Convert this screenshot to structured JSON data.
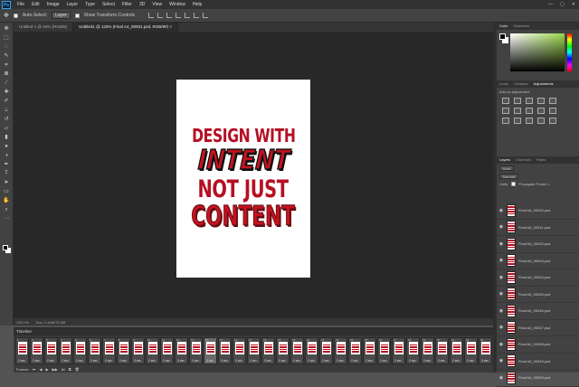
{
  "app": {
    "logo": "Ps"
  },
  "menu": [
    "File",
    "Edit",
    "Image",
    "Layer",
    "Type",
    "Select",
    "Filter",
    "3D",
    "View",
    "Window",
    "Help"
  ],
  "window_controls": [
    "—",
    "▢",
    "✕"
  ],
  "options": {
    "auto_select_label": "Auto-Select:",
    "auto_select_value": "Layer",
    "transform_label": "Show Transform Controls"
  },
  "tabs": [
    {
      "label": "Untitled-1 @ 50% (RGB/8)",
      "active": false
    },
    {
      "label": "Untitled1 @ 133% (Final A4_00001.psd, RGB/8#) ×",
      "active": true
    }
  ],
  "artwork": {
    "line1": "DESIGN WITH",
    "line2": "INTENT",
    "line3": "NOT JUST",
    "line4": "CONTENT",
    "red": "#b50f22"
  },
  "status": {
    "zoom": "133.1%",
    "doc": "Doc: 1.44M/72.2M"
  },
  "timeline": {
    "title": "Timeline",
    "loop_label": "Forever",
    "frames": [
      {
        "num": "1",
        "dur": "0 sec.",
        "active": false
      },
      {
        "num": "2",
        "dur": "0 sec.",
        "active": false
      },
      {
        "num": "3",
        "dur": "0 sec.",
        "active": false
      },
      {
        "num": "4",
        "dur": "0 sec.",
        "active": false
      },
      {
        "num": "5",
        "dur": "0 sec.",
        "active": false
      },
      {
        "num": "6",
        "dur": "0 sec.",
        "active": false
      },
      {
        "num": "7",
        "dur": "0 sec.",
        "active": false
      },
      {
        "num": "8",
        "dur": "0 sec.",
        "active": false
      },
      {
        "num": "9",
        "dur": "0 sec.",
        "active": false
      },
      {
        "num": "10",
        "dur": "0 sec.",
        "active": false
      },
      {
        "num": "11",
        "dur": "0 sec.",
        "active": false
      },
      {
        "num": "12",
        "dur": "0 sec.",
        "active": false
      },
      {
        "num": "13",
        "dur": "0 sec.",
        "active": false
      },
      {
        "num": "14",
        "dur": "0 sec.",
        "active": true
      },
      {
        "num": "15",
        "dur": "0 sec.",
        "active": false
      },
      {
        "num": "16",
        "dur": "0 sec.",
        "active": false
      },
      {
        "num": "17",
        "dur": "0 sec.",
        "active": false
      },
      {
        "num": "18",
        "dur": "0 sec.",
        "active": false
      },
      {
        "num": "19",
        "dur": "0 sec.",
        "active": false
      },
      {
        "num": "20",
        "dur": "0 sec.",
        "active": false
      },
      {
        "num": "21",
        "dur": "0 sec.",
        "active": false
      },
      {
        "num": "22",
        "dur": "0 sec.",
        "active": false
      },
      {
        "num": "23",
        "dur": "0 sec.",
        "active": false
      },
      {
        "num": "24",
        "dur": "0 sec.",
        "active": false
      },
      {
        "num": "25",
        "dur": "0 sec.",
        "active": false
      },
      {
        "num": "26",
        "dur": "0 sec.",
        "active": false
      },
      {
        "num": "27",
        "dur": "0 sec.",
        "active": false
      },
      {
        "num": "28",
        "dur": "0 sec.",
        "active": false
      },
      {
        "num": "29",
        "dur": "0 sec.",
        "active": false
      },
      {
        "num": "30",
        "dur": "0 sec.",
        "active": false
      },
      {
        "num": "31",
        "dur": "0 sec.",
        "active": false
      },
      {
        "num": "32",
        "dur": "0 sec.",
        "active": false
      },
      {
        "num": "33",
        "dur": "0 sec.",
        "active": false
      }
    ]
  },
  "color_panel": {
    "tabs": [
      "Color",
      "Swatches"
    ],
    "fg": "#000000",
    "bg": "#ffffff"
  },
  "adjust_panel": {
    "tabs": [
      "Learn",
      "Libraries",
      "Adjustments"
    ],
    "label": "Add an adjustment"
  },
  "layers_panel": {
    "tabs": [
      "Layers",
      "Channels",
      "Paths"
    ],
    "kind_label": "Kind",
    "blend_mode": "Normal",
    "unify_label": "Unify:",
    "propagate_label": "Propagate Frame 1",
    "layers": [
      "Final A4_00040.psd",
      "Final A4_00041.psd",
      "Final A4_00042.psd",
      "Final A4_00043.psd",
      "Final A4_00044.psd",
      "Final A4_00045.psd",
      "Final A4_00046.psd",
      "Final A4_00047.psd",
      "Final A4_00048.psd",
      "Final A4_00049.psd",
      "Final A4_00050.psd"
    ]
  }
}
